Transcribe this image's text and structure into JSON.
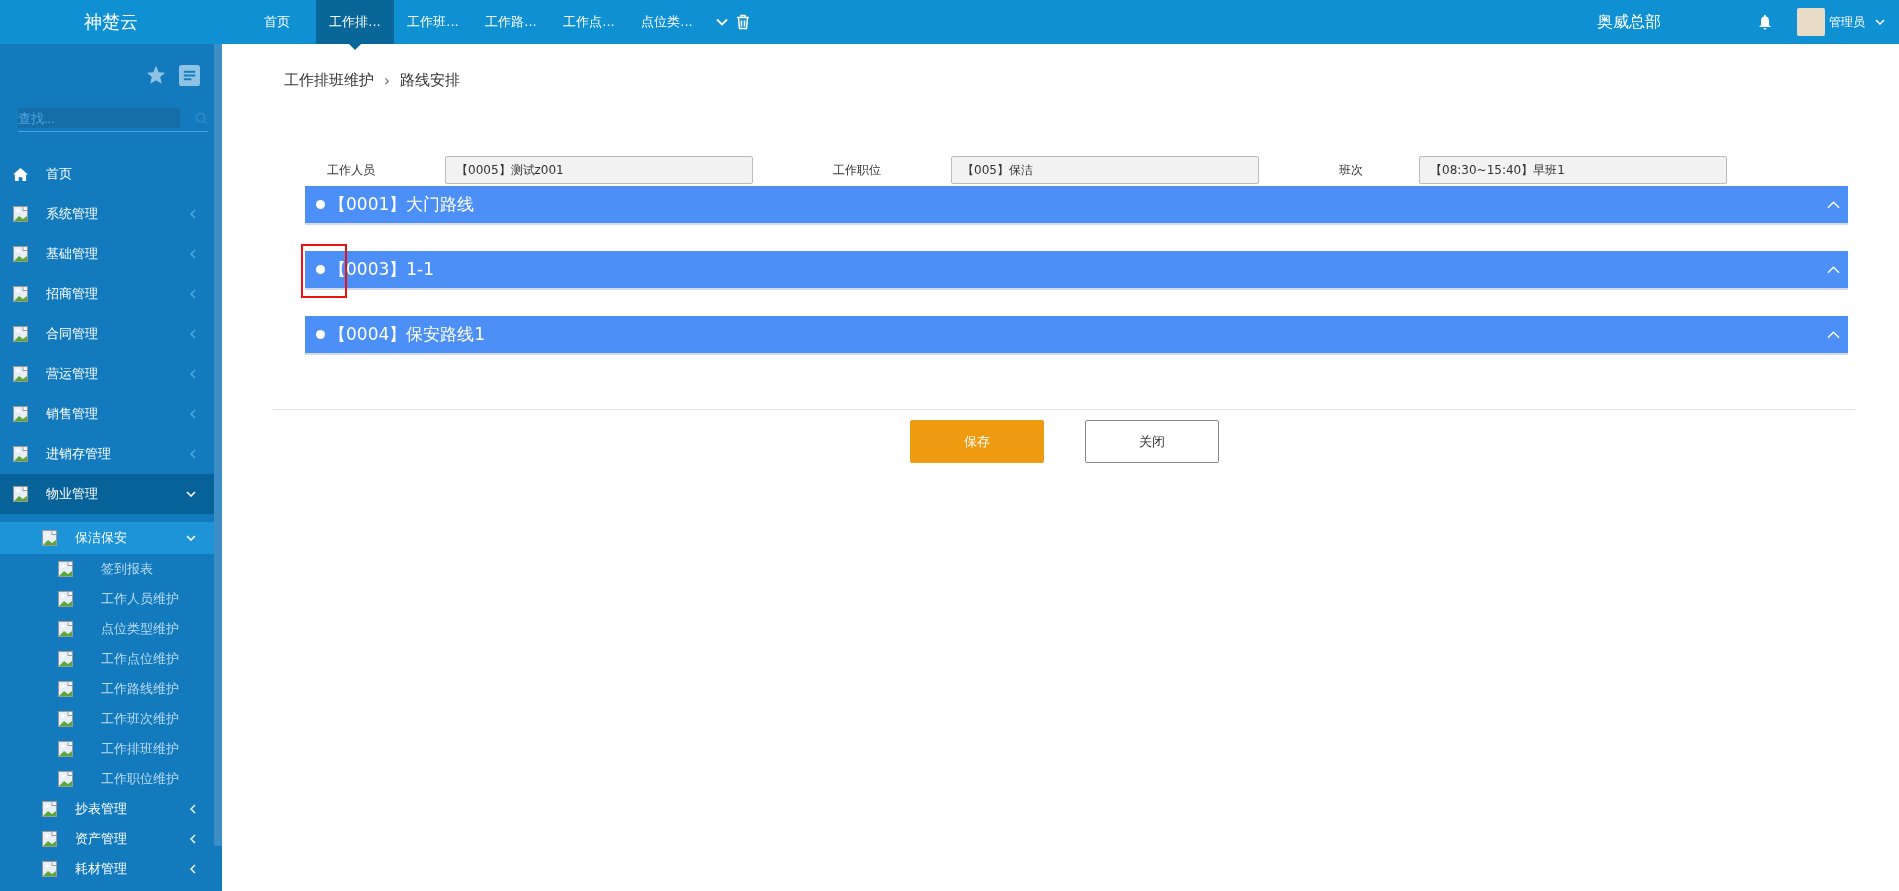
{
  "brand": "神楚云",
  "tabs": [
    {
      "label": "首页",
      "selected": false
    },
    {
      "label": "工作排...",
      "selected": true
    },
    {
      "label": "工作班...",
      "selected": false
    },
    {
      "label": "工作路...",
      "selected": false
    },
    {
      "label": "工作点...",
      "selected": false
    },
    {
      "label": "点位类...",
      "selected": false
    }
  ],
  "org": "奥威总部",
  "user": "管理员",
  "sidebar": {
    "search": {
      "placeholder": "查找..."
    },
    "items": [
      {
        "kind": "home",
        "label": "首页"
      },
      {
        "kind": "group",
        "label": "系统管理",
        "expanded": false
      },
      {
        "kind": "group",
        "label": "基础管理",
        "expanded": false
      },
      {
        "kind": "group",
        "label": "招商管理",
        "expanded": false
      },
      {
        "kind": "group",
        "label": "合同管理",
        "expanded": false
      },
      {
        "kind": "group",
        "label": "营运管理",
        "expanded": false
      },
      {
        "kind": "group",
        "label": "销售管理",
        "expanded": false
      },
      {
        "kind": "group",
        "label": "进销存管理",
        "expanded": false
      },
      {
        "kind": "group",
        "label": "物业管理",
        "expanded": true,
        "children": [
          {
            "kind": "group",
            "label": "保洁保安",
            "expanded": true,
            "children": [
              {
                "kind": "leaf",
                "label": "签到报表"
              },
              {
                "kind": "leaf",
                "label": "工作人员维护"
              },
              {
                "kind": "leaf",
                "label": "点位类型维护"
              },
              {
                "kind": "leaf",
                "label": "工作点位维护"
              },
              {
                "kind": "leaf",
                "label": "工作路线维护"
              },
              {
                "kind": "leaf",
                "label": "工作班次维护"
              },
              {
                "kind": "leaf",
                "label": "工作排班维护"
              },
              {
                "kind": "leaf",
                "label": "工作职位维护"
              }
            ]
          },
          {
            "kind": "group",
            "label": "抄表管理",
            "expanded": false
          },
          {
            "kind": "group",
            "label": "资产管理",
            "expanded": false
          },
          {
            "kind": "group",
            "label": "耗材管理",
            "expanded": false
          }
        ]
      }
    ]
  },
  "breadcrumb": [
    "工作排班维护",
    "路线安排"
  ],
  "breadcrumb_separator": "›",
  "fields": [
    {
      "label": "工作人员",
      "value": "【0005】测试z001"
    },
    {
      "label": "工作职位",
      "value": "【005】保洁"
    },
    {
      "label": "班次",
      "value": "【08:30~15:40】早班1"
    }
  ],
  "routes": [
    {
      "title": "【0001】大门路线"
    },
    {
      "title": "【0003】1-1",
      "highlighted": true
    },
    {
      "title": "【0004】保安路线1"
    }
  ],
  "buttons": [
    {
      "kind": "primary",
      "label": "保存"
    },
    {
      "kind": "default",
      "label": "关闭"
    }
  ]
}
